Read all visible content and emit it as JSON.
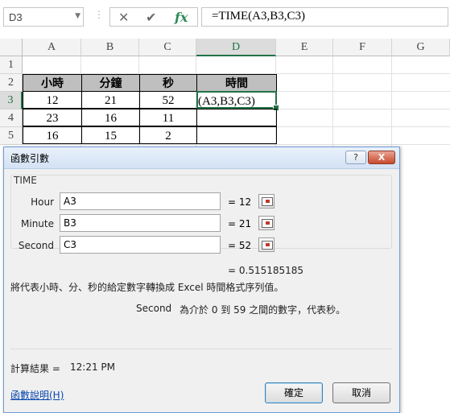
{
  "formula_bar": {
    "name_box": "D3",
    "dots": "⋮",
    "cancel_glyph": "✕",
    "enter_glyph": "✔",
    "fx_glyph": "fx",
    "formula": "=TIME(A3,B3,C3)"
  },
  "columns": [
    "A",
    "B",
    "C",
    "D",
    "E",
    "F",
    "G"
  ],
  "rows": [
    "1",
    "2",
    "3",
    "4",
    "5"
  ],
  "table": {
    "headers": [
      "小時",
      "分鐘",
      "秒",
      "時間"
    ],
    "data": [
      [
        "12",
        "21",
        "52",
        "(A3,B3,C3)"
      ],
      [
        "23",
        "16",
        "11",
        ""
      ],
      [
        "16",
        "15",
        "2",
        ""
      ]
    ]
  },
  "dialog": {
    "title": "函數引數",
    "help_btn": "?",
    "close_btn": "X",
    "function_name": "TIME",
    "args": [
      {
        "label": "Hour",
        "value": "A3",
        "result": "= 12"
      },
      {
        "label": "Minute",
        "value": "B3",
        "result": "= 21"
      },
      {
        "label": "Second",
        "value": "C3",
        "result": "= 52"
      }
    ],
    "overall_result": "= 0.515185185",
    "description": "將代表小時、分、秒的給定數字轉換成 Excel 時間格式序列值。",
    "arg_help_name": "Second",
    "arg_help_text": "為介於 0 到 59 之間的數字，代表秒。",
    "calc_result_label": "計算結果 =",
    "calc_result_value": "12:21 PM",
    "help_link": "函數說明(H)",
    "ok_label": "確定",
    "cancel_label": "取消"
  }
}
